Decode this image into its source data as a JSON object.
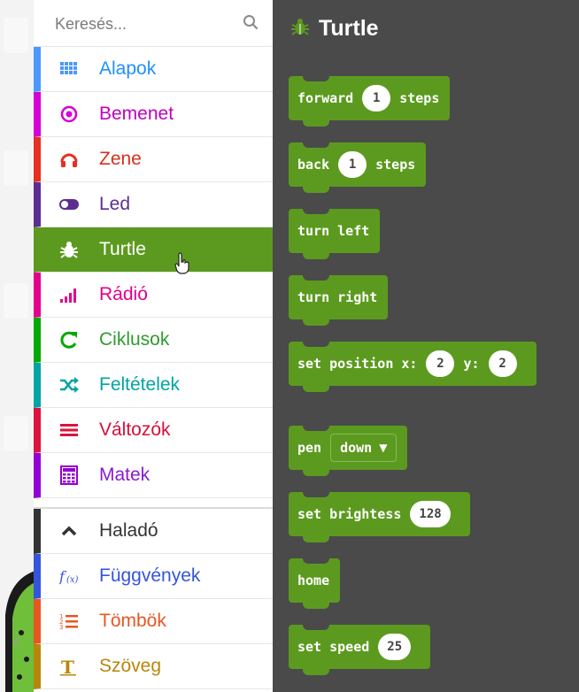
{
  "search": {
    "placeholder": "Keresés..."
  },
  "categories": [
    {
      "label": "Alapok",
      "icon": "grid-icon",
      "color": "#4c97ff",
      "text_color": "#1e90ff"
    },
    {
      "label": "Bemenet",
      "icon": "target-icon",
      "color": "#d400d4",
      "text_color": "#c000c0"
    },
    {
      "label": "Zene",
      "icon": "headphones-icon",
      "color": "#e63022",
      "text_color": "#d6301e"
    },
    {
      "label": "Led",
      "icon": "toggle-icon",
      "color": "#5c2d91",
      "text_color": "#5c2d91"
    },
    {
      "label": "Turtle",
      "icon": "bug-icon",
      "color": "#5c9a1f",
      "text_color": "#ffffff",
      "selected": true
    },
    {
      "label": "Rádió",
      "icon": "signal-icon",
      "color": "#e3008c",
      "text_color": "#e3008c"
    },
    {
      "label": "Ciklusok",
      "icon": "refresh-icon",
      "color": "#00aa00",
      "text_color": "#2e9b2e"
    },
    {
      "label": "Feltételek",
      "icon": "shuffle-icon",
      "color": "#00a4a6",
      "text_color": "#00a4a6"
    },
    {
      "label": "Változók",
      "icon": "lines-icon",
      "color": "#dc143c",
      "text_color": "#d6103a"
    },
    {
      "label": "Matek",
      "icon": "calculator-icon",
      "color": "#9400d3",
      "text_color": "#8a1bd0"
    }
  ],
  "advanced": [
    {
      "label": "Haladó",
      "icon": "chevron-up-icon",
      "color": "#333333",
      "text_color": "#333333"
    },
    {
      "label": "Függvények",
      "icon": "function-icon",
      "color": "#3455db",
      "text_color": "#3455db"
    },
    {
      "label": "Tömbök",
      "icon": "list-icon",
      "color": "#e65722",
      "text_color": "#e65722"
    },
    {
      "label": "Szöveg",
      "icon": "text-icon",
      "color": "#b8860b",
      "text_color": "#b8860b"
    }
  ],
  "flyout": {
    "title": "Turtle",
    "blocks": [
      {
        "parts": [
          "forward",
          "1",
          "steps"
        ]
      },
      {
        "parts": [
          "back",
          "1",
          "steps"
        ]
      },
      {
        "parts": [
          "turn left"
        ]
      },
      {
        "parts": [
          "turn right"
        ]
      },
      {
        "parts": [
          "set position x:",
          "2",
          "y:",
          "2"
        ]
      },
      {
        "parts": [
          "pen",
          "down"
        ]
      },
      {
        "parts": [
          "set brightess",
          "128"
        ]
      },
      {
        "parts": [
          "home"
        ]
      },
      {
        "parts": [
          "set speed",
          "25"
        ]
      }
    ]
  },
  "colors": {
    "accent": "#5c9a1f",
    "workspace": "#4a4a4a"
  }
}
